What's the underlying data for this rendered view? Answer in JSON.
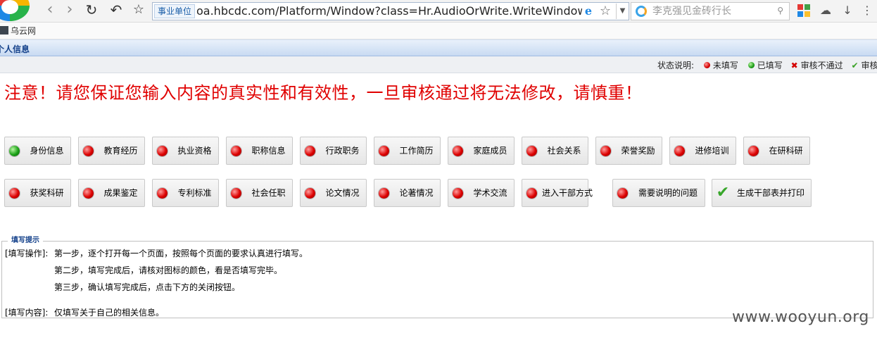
{
  "browser": {
    "address_badge": "事业单位",
    "url": "oa.hbcdc.com/Platform/Window?class=Hr.AudioOrWrite.WriteWindowPar",
    "search_placeholder": "李克强见金砖行长",
    "ie_glyph": "e",
    "icons": [
      "back-icon",
      "forward-icon",
      "reload-icon",
      "undo-icon",
      "star-icon",
      "search-icon",
      "apps-icon",
      "cloud-icon",
      "download-icon",
      "menu-icon"
    ]
  },
  "bookmarks": [
    {
      "label": "乌云网"
    }
  ],
  "window": {
    "title": "个人信息"
  },
  "legend": {
    "label": "状态说明:",
    "items": [
      {
        "icon": "red-dot-icon",
        "text": "未填写"
      },
      {
        "icon": "green-dot-icon",
        "text": "已填写"
      },
      {
        "icon": "x-mark-icon",
        "text": "审核不通过"
      },
      {
        "icon": "check-icon",
        "text": "审核通"
      }
    ]
  },
  "warning": "注意！请您保证您输入内容的真实性和有效性，一旦审核通过将无法修改，请慎重！",
  "sections": {
    "row1": [
      {
        "label": "身份信息",
        "status": "green"
      },
      {
        "label": "教育经历",
        "status": "red"
      },
      {
        "label": "执业资格",
        "status": "red"
      },
      {
        "label": "职称信息",
        "status": "red"
      },
      {
        "label": "行政职务",
        "status": "red"
      },
      {
        "label": "工作简历",
        "status": "red"
      },
      {
        "label": "家庭成员",
        "status": "red"
      },
      {
        "label": "社会关系",
        "status": "red"
      },
      {
        "label": "荣誉奖励",
        "status": "red"
      },
      {
        "label": "进修培训",
        "status": "red"
      },
      {
        "label": "在研科研",
        "status": "red"
      }
    ],
    "row2": [
      {
        "label": "获奖科研",
        "status": "red"
      },
      {
        "label": "成果鉴定",
        "status": "red"
      },
      {
        "label": "专利标准",
        "status": "red"
      },
      {
        "label": "社会任职",
        "status": "red"
      },
      {
        "label": "论文情况",
        "status": "red"
      },
      {
        "label": "论著情况",
        "status": "red"
      },
      {
        "label": "学术交流",
        "status": "red"
      },
      {
        "label": "进入干部方式",
        "status": "red"
      },
      {
        "label": "需要说明的问题",
        "status": "red"
      },
      {
        "label": "生成干部表并打印",
        "status": "check"
      }
    ]
  },
  "hints": {
    "legend": "填写提示",
    "operation_label": "[填写操作]:",
    "step1": "第一步，逐个打开每一个页面，按照每个页面的要求认真进行填写。",
    "step2": "第二步，填写完成后，请核对图标的颜色，看是否填写完毕。",
    "step3": "第三步，确认填写完成后，点击下方的关闭按钮。",
    "content_label": "[填写内容]:",
    "content": "仅填写关于自己的相关信息。"
  },
  "watermark": "www.wooyun.org",
  "colors": {
    "warning": "#e00000",
    "title": "#15428b",
    "ok": "#1a9c16",
    "pending": "#d40000"
  }
}
